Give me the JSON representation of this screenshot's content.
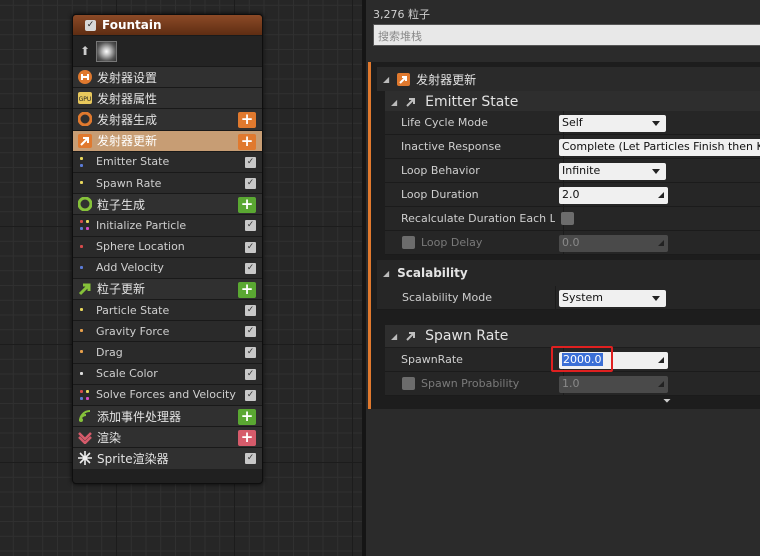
{
  "node": {
    "title": "Fountain",
    "rows": [
      {
        "kind": "grp",
        "label": "发射器设置",
        "icon": "emitter-settings-icon",
        "btn": null
      },
      {
        "kind": "grp",
        "label": "发射器属性",
        "icon": "gpu-icon",
        "btn": null
      },
      {
        "kind": "grp",
        "label": "发射器生成",
        "icon": "emitter-spawn-icon",
        "btn": "add"
      },
      {
        "kind": "sel",
        "label": "发射器更新",
        "icon": "emitter-update-icon",
        "btn": "add"
      },
      {
        "kind": "sub",
        "label": "Emitter State",
        "dots": [
          "#e8d65c",
          "#5b7bd6"
        ],
        "check": true
      },
      {
        "kind": "sub",
        "label": "Spawn Rate",
        "dots": [
          "#e8d65c"
        ],
        "check": true
      },
      {
        "kind": "grp",
        "label": "粒子生成",
        "icon": "particle-spawn-icon",
        "btn": "add"
      },
      {
        "kind": "sub",
        "label": "Initialize Particle",
        "dots": [
          "#d64b4b",
          "#5b7bd6",
          "#e8d65c",
          "#d64bc4"
        ],
        "check": true
      },
      {
        "kind": "sub",
        "label": "Sphere Location",
        "dots": [
          "#d64b4b"
        ],
        "check": true
      },
      {
        "kind": "sub",
        "label": "Add Velocity",
        "dots": [
          "#5b7bd6"
        ],
        "check": true
      },
      {
        "kind": "grp",
        "label": "粒子更新",
        "icon": "particle-update-icon",
        "btn": "add"
      },
      {
        "kind": "sub",
        "label": "Particle State",
        "dots": [
          "#e8d65c"
        ],
        "check": true
      },
      {
        "kind": "sub",
        "label": "Gravity Force",
        "dots": [
          "#e8a04b"
        ],
        "check": true
      },
      {
        "kind": "sub",
        "label": "Drag",
        "dots": [
          "#e8a04b"
        ],
        "check": true
      },
      {
        "kind": "sub",
        "label": "Scale Color",
        "dots": [
          "#dddddd"
        ],
        "check": true
      },
      {
        "kind": "sub",
        "label": "Solve Forces and Velocity",
        "dots": [
          "#d64b4b",
          "#5b7bd6",
          "#e8d65c",
          "#d64bc4"
        ],
        "check": true
      },
      {
        "kind": "grp",
        "label": "添加事件处理器",
        "icon": "event-handler-icon",
        "btn": "add"
      },
      {
        "kind": "grp",
        "label": "渲染",
        "icon": "render-icon",
        "btn": "addred"
      },
      {
        "kind": "grp",
        "label": "Sprite渲染器",
        "icon": "sprite-icon",
        "check": true
      }
    ]
  },
  "panel": {
    "particle_count": "3,276 粒子",
    "search_placeholder": "搜索堆栈",
    "section_title": "发射器更新",
    "emitter_state": {
      "title": "Emitter State",
      "life_cycle_mode_label": "Life Cycle Mode",
      "life_cycle_mode_value": "Self",
      "inactive_response_label": "Inactive Response",
      "inactive_response_value": "Complete (Let Particles Finish then Kill",
      "loop_behavior_label": "Loop Behavior",
      "loop_behavior_value": "Infinite",
      "loop_duration_label": "Loop Duration",
      "loop_duration_value": "2.0",
      "recalc_label": "Recalculate Duration Each Loo",
      "loop_delay_label": "Loop Delay",
      "loop_delay_value": "0.0"
    },
    "scalability": {
      "title": "Scalability",
      "mode_label": "Scalability Mode",
      "mode_value": "System"
    },
    "spawn_rate": {
      "title": "Spawn Rate",
      "spawnrate_label": "SpawnRate",
      "spawnrate_value": "2000.0",
      "probability_label": "Spawn Probability",
      "probability_value": "1.0"
    }
  }
}
